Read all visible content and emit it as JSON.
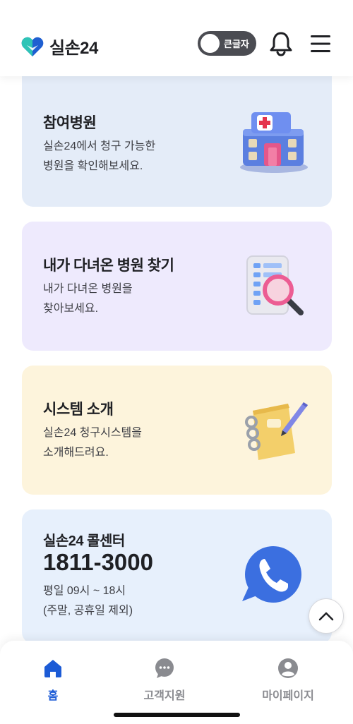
{
  "header": {
    "logo_text": "실손24",
    "toggle_label": "큰글자",
    "brand_colors": {
      "heart_teal": "#2ec4b6",
      "heart_blue": "#1f5fd1"
    }
  },
  "cards": [
    {
      "title": "참여병원",
      "desc_lines": [
        "실손24에서 청구 가능한",
        "병원을 확인해보세요."
      ],
      "illustration": "hospital-building-icon",
      "bg": "#e4ecf8"
    },
    {
      "title": "내가 다녀온 병원 찾기",
      "desc_lines": [
        "내가 다녀온 병원을",
        "찾아보세요."
      ],
      "illustration": "document-magnifier-icon",
      "bg": "#eeeafd"
    },
    {
      "title": "시스템 소개",
      "desc_lines": [
        "실손24 청구시스템을",
        "소개해드려요."
      ],
      "illustration": "notebook-pencil-icon",
      "bg": "#fdf4dc"
    },
    {
      "title": "실손24 콜센터",
      "phone": "1811-3000",
      "desc_lines": [
        "평일 09시 ~ 18시",
        "(주말, 공휴일 제외)"
      ],
      "illustration": "phone-chat-bubble-icon",
      "bg": "#e7f0fc"
    }
  ],
  "bottom_nav": [
    {
      "label": "홈",
      "icon": "home-icon",
      "active": true,
      "color": "#1c5bd6"
    },
    {
      "label": "고객지원",
      "icon": "chat-bubble-icon",
      "active": false,
      "color": "#8a8b90"
    },
    {
      "label": "마이페이지",
      "icon": "user-icon",
      "active": false,
      "color": "#8a8b90"
    }
  ]
}
